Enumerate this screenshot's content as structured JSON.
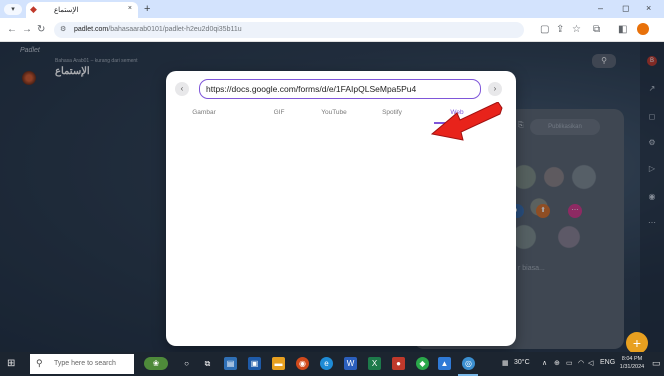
{
  "browser": {
    "tab": {
      "title": "الإستماع",
      "close": "×"
    },
    "new_tab": "+",
    "window": {
      "minimize": "–",
      "maximize": "◻",
      "close": "×"
    },
    "address": {
      "host": "padlet.com",
      "path": "/bahasaarab0101/padlet-h2eu2d0qi35b11u"
    }
  },
  "padlet": {
    "brand": "Padlet",
    "board_author": "Bahasa Arab01 – kurang dari sement",
    "board_title": "الإستماع",
    "post_card": {
      "publish_label": "Publikasikan",
      "placeholder": "r biasa..."
    }
  },
  "modal": {
    "url_value": "https://docs.google.com/forms/d/e/1FAIpQLSeMpa5Pu4",
    "tabs": [
      {
        "label": "Gambar"
      },
      {
        "label": "GIF"
      },
      {
        "label": "YouTube"
      },
      {
        "label": "Spotify"
      },
      {
        "label": "Web"
      }
    ],
    "active_tab": "Web",
    "accent_color": "#7f56d9"
  },
  "taskbar": {
    "search_placeholder": "Type here to search",
    "weather": "30°C",
    "language": "ENG",
    "time": "8:04 PM",
    "date": "1/31/2024"
  },
  "colors": {
    "annotation_arrow": "#e8231b",
    "fab": "#e8a020"
  }
}
